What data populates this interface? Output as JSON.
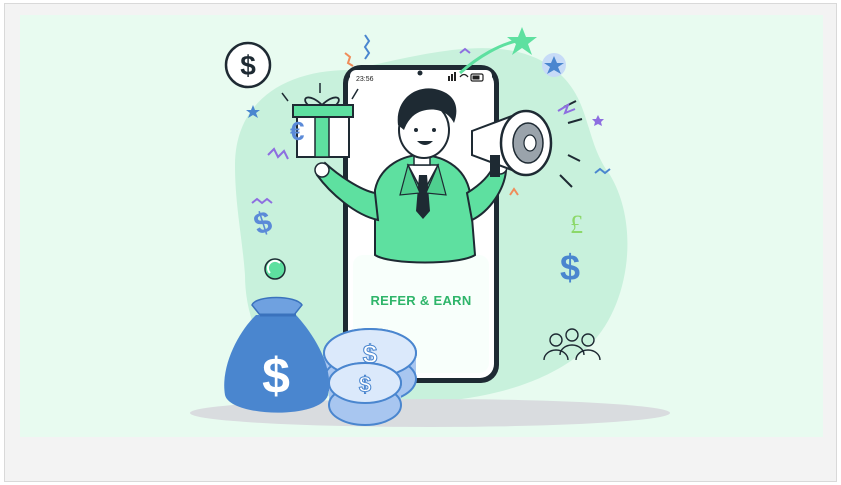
{
  "illustration": {
    "phone": {
      "time": "23:56",
      "headline": "REFER & EARN"
    },
    "currency_symbols": [
      "$",
      "€",
      "£"
    ],
    "icons": [
      "dollar-coin-icon",
      "star-icon",
      "megaphone-icon",
      "gift-box-icon",
      "money-bag-icon",
      "coin-stack-icon",
      "people-group-icon"
    ],
    "colors": {
      "background": "#e8fbf0",
      "blob": "#c8f1dc",
      "accent_green": "#5ee0a0",
      "brand_text": "#2fb56a",
      "bag_blue": "#4a86cf",
      "outline": "#1e2a33"
    }
  }
}
